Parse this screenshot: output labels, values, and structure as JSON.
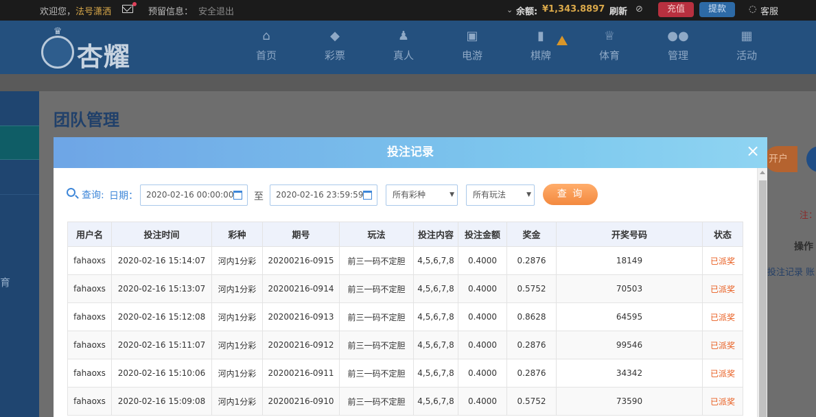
{
  "topbar": {
    "welcome": "欢迎您，",
    "username": "法号潇洒",
    "reserve_info": "预留信息：",
    "logout": "安全退出",
    "balance_label": "余额:",
    "balance_value": "¥1,343.8897",
    "refresh": "刷新",
    "recharge": "充值",
    "withdraw": "提款",
    "service": "客服"
  },
  "header": {
    "logo_text": "杏耀",
    "nav": [
      {
        "label": "首页",
        "icon": "home-icon"
      },
      {
        "label": "彩票",
        "icon": "diamond-icon"
      },
      {
        "label": "真人",
        "icon": "person-icon"
      },
      {
        "label": "电游",
        "icon": "slot-icon"
      },
      {
        "label": "棋牌",
        "icon": "cards-icon"
      },
      {
        "label": "体育",
        "icon": "trophy-icon"
      },
      {
        "label": "管理",
        "icon": "users-icon"
      },
      {
        "label": "活动",
        "icon": "gift-icon"
      }
    ]
  },
  "sidebar": {
    "partial_text": "育"
  },
  "page": {
    "title": "团队管理",
    "kaihu_partial": "开户",
    "note_partial": "注：",
    "ops_header": "操作",
    "link_partial": "投注记录 账"
  },
  "modal": {
    "title": "投注记录",
    "close": "×",
    "filters": {
      "query_label": "查询:",
      "date_label": "日期：",
      "start_date": "2020-02-16 00:00:00",
      "to_label": "至",
      "end_date": "2020-02-16 23:59:59",
      "lottery_select": "所有彩种",
      "play_select": "所有玩法",
      "query_button": "查 询"
    },
    "table": {
      "columns": [
        "用户名",
        "投注时间",
        "彩种",
        "期号",
        "玩法",
        "投注内容",
        "投注金额",
        "奖金",
        "开奖号码",
        "状态"
      ],
      "rows": [
        [
          "fahaoxs",
          "2020-02-16 15:14:07",
          "河内1分彩",
          "20200216-0915",
          "前三一码不定胆",
          "4,5,6,7,8",
          "0.4000",
          "0.2876",
          "18149",
          "已派奖"
        ],
        [
          "fahaoxs",
          "2020-02-16 15:13:07",
          "河内1分彩",
          "20200216-0914",
          "前三一码不定胆",
          "4,5,6,7,8",
          "0.4000",
          "0.5752",
          "70503",
          "已派奖"
        ],
        [
          "fahaoxs",
          "2020-02-16 15:12:08",
          "河内1分彩",
          "20200216-0913",
          "前三一码不定胆",
          "4,5,6,7,8",
          "0.4000",
          "0.8628",
          "64595",
          "已派奖"
        ],
        [
          "fahaoxs",
          "2020-02-16 15:11:07",
          "河内1分彩",
          "20200216-0912",
          "前三一码不定胆",
          "4,5,6,7,8",
          "0.4000",
          "0.2876",
          "99546",
          "已派奖"
        ],
        [
          "fahaoxs",
          "2020-02-16 15:10:06",
          "河内1分彩",
          "20200216-0911",
          "前三一码不定胆",
          "4,5,6,7,8",
          "0.4000",
          "0.2876",
          "34342",
          "已派奖"
        ],
        [
          "fahaoxs",
          "2020-02-16 15:09:08",
          "河内1分彩",
          "20200216-0910",
          "前三一码不定胆",
          "4,5,6,7,8",
          "0.4000",
          "0.5752",
          "73590",
          "已派奖"
        ]
      ]
    }
  },
  "colors": {
    "status": "#e85a1b",
    "accent": "#3d86d8",
    "query_button": "#f3893f",
    "balance": "#d9a84a"
  }
}
